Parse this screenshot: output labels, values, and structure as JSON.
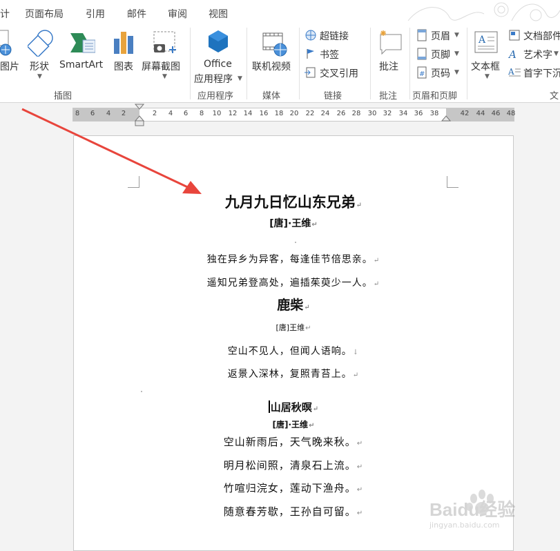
{
  "tabs": [
    "计",
    "页面布局",
    "引用",
    "邮件",
    "审阅",
    "视图"
  ],
  "ribbon": {
    "insert_group": {
      "picture": "图片",
      "shapes": "形状",
      "smartart": "SmartArt",
      "chart": "图表",
      "screenshot": "屏幕截图",
      "label": "插图"
    },
    "apps_group": {
      "office_line1": "Office",
      "office_line2": "应用程序",
      "label": "应用程序"
    },
    "media_group": {
      "online_video": "联机视频",
      "label": "媒体"
    },
    "links_group": {
      "hyperlink": "超链接",
      "bookmark": "书签",
      "crossref": "交叉引用",
      "label": "链接"
    },
    "comments_group": {
      "comment": "批注",
      "label": "批注"
    },
    "header_footer_group": {
      "header": "页眉",
      "footer": "页脚",
      "page_number": "页码",
      "label": "页眉和页脚"
    },
    "text_group": {
      "textbox": "文本框",
      "doc_parts": "文档部件",
      "wordart": "艺术字",
      "dropcap": "首字下沉",
      "label": "文"
    }
  },
  "ruler": {
    "left_numbers": [
      "8",
      "6",
      "4",
      "2"
    ],
    "right_numbers": [
      "2",
      "4",
      "6",
      "8",
      "10",
      "12",
      "14",
      "16",
      "18",
      "20",
      "22",
      "24",
      "26",
      "28",
      "30",
      "32",
      "34",
      "36",
      "38",
      "42",
      "44",
      "46",
      "48"
    ]
  },
  "document": {
    "poem1": {
      "title": "九月九日忆山东兄弟",
      "author": "[唐]·王维",
      "lines": [
        "独在异乡为异客，每逢佳节倍思亲。",
        "遥知兄弟登高处，遍插茱萸少一人。"
      ]
    },
    "poem2": {
      "title": "鹿柴",
      "author": "[唐]王维",
      "lines": [
        "空山不见人，但闻人语响。",
        "返景入深林，复照青苔上。"
      ]
    },
    "poem3": {
      "title": "山居秋暝",
      "author": "[唐]·王维",
      "lines": [
        "空山新雨后，天气晚来秋。",
        "明月松间照，清泉石上流。",
        "竹喧归浣女，莲动下渔舟。",
        "随意春芳歇，王孙自可留。"
      ]
    }
  },
  "watermark": {
    "brand": "Baidu经验",
    "url": "jingyan.baidu.com"
  },
  "colors": {
    "arrow": "#e8453c",
    "office_blue": "#1e73be",
    "ribbon_bg": "#ffffff",
    "app_bg": "#f3f3f3"
  }
}
